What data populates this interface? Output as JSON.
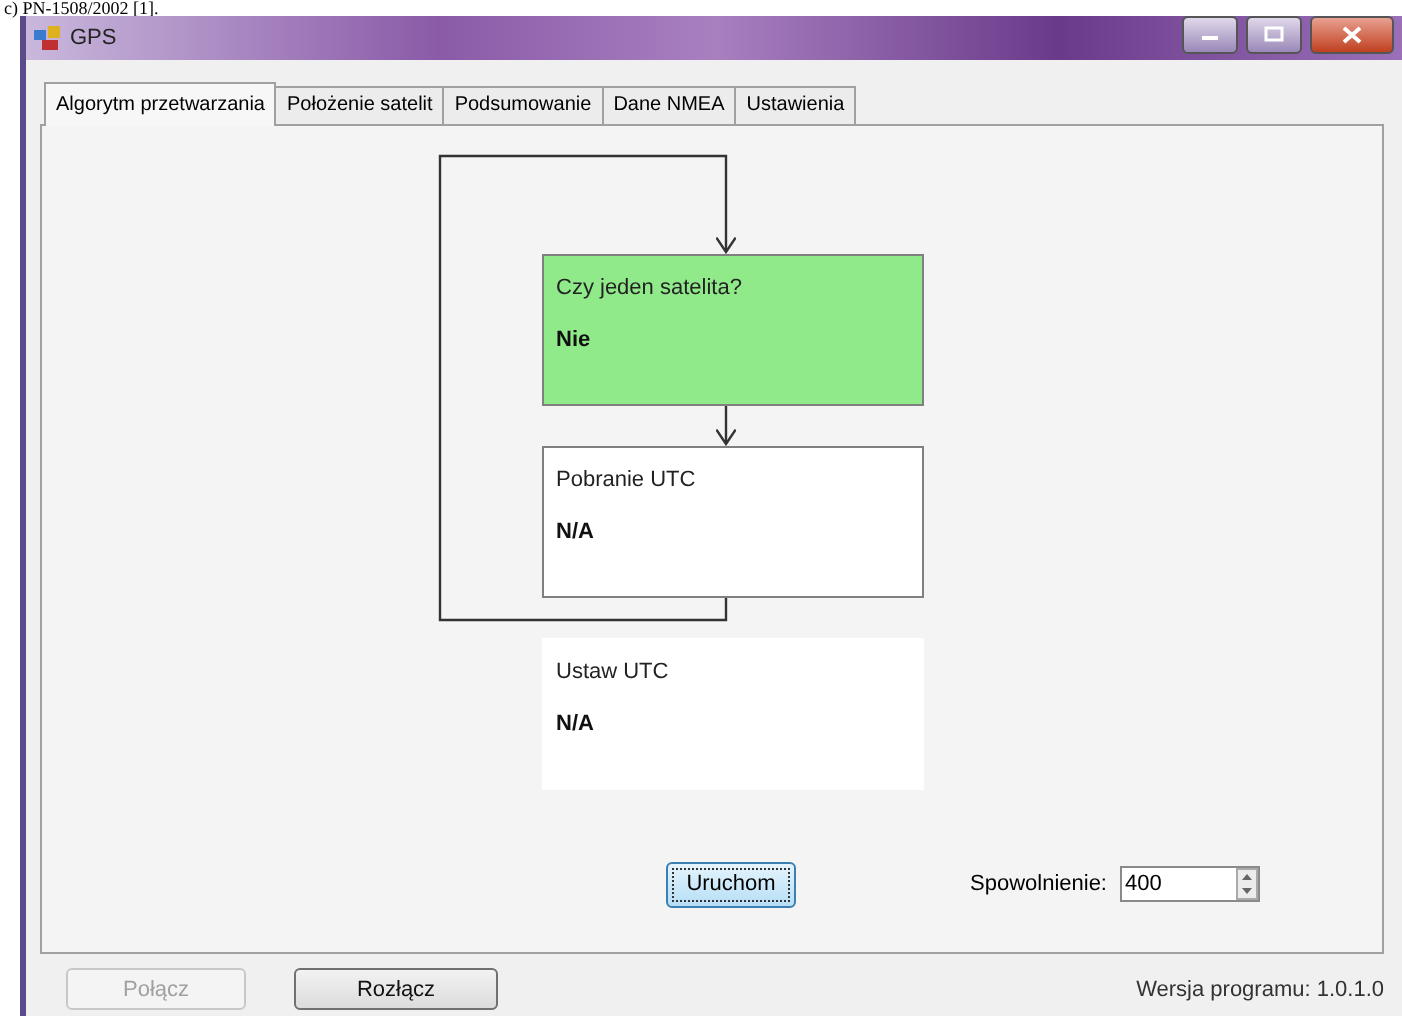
{
  "caption": "c) PN-1508/2002 [1].",
  "window": {
    "title": "GPS"
  },
  "tabs": [
    {
      "label": "Algorytm przetwarzania",
      "selected": true
    },
    {
      "label": "Położenie satelit",
      "selected": false
    },
    {
      "label": "Podsumowanie",
      "selected": false
    },
    {
      "label": "Dane NMEA",
      "selected": false
    },
    {
      "label": "Ustawienia",
      "selected": false
    }
  ],
  "flow_nodes": [
    {
      "title": "Czy jeden satelita?",
      "value": "Nie",
      "active": true,
      "outlined": true
    },
    {
      "title": "Pobranie UTC",
      "value": "N/A",
      "active": false,
      "outlined": true
    },
    {
      "title": "Ustaw UTC",
      "value": "N/A",
      "active": false,
      "outlined": false
    }
  ],
  "run_button": {
    "label": "Uruchom"
  },
  "delay": {
    "label": "Spowolnienie:",
    "value": "400"
  },
  "buttons": [
    {
      "label": "Połącz",
      "disabled": true
    },
    {
      "label": "Rozłącz",
      "disabled": false
    }
  ],
  "version": "Wersja programu: 1.0.1.0"
}
